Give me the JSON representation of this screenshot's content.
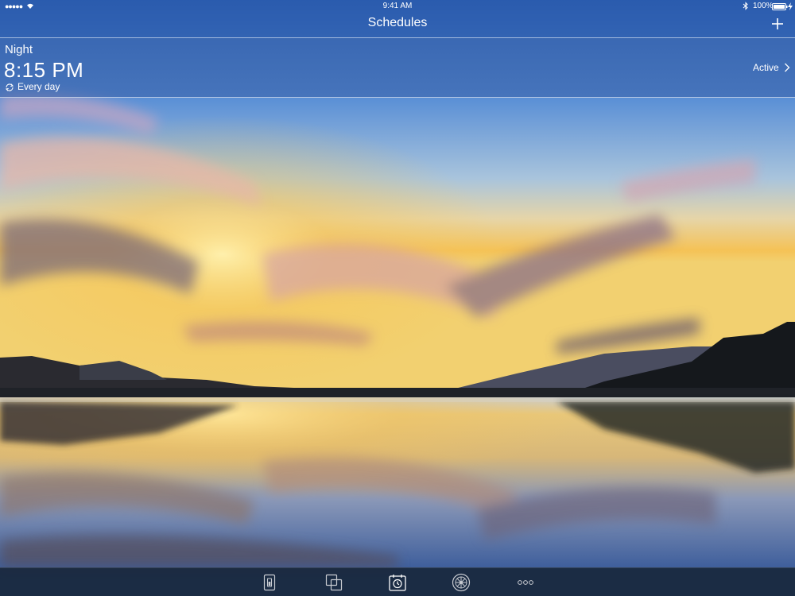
{
  "status_bar": {
    "signal": "●●●●●",
    "time": "9:41 AM",
    "battery_percent": "100%"
  },
  "nav": {
    "title": "Schedules",
    "add_icon": "plus-icon"
  },
  "schedule": {
    "name": "Night",
    "time": "8:15 PM",
    "repeat": "Every day",
    "status": "Active"
  },
  "tabs": [
    {
      "icon": "device-icon"
    },
    {
      "icon": "scenes-icon"
    },
    {
      "icon": "schedules-icon",
      "selected": true
    },
    {
      "icon": "automation-icon"
    },
    {
      "icon": "more-icon"
    }
  ],
  "colors": {
    "nav_bg": "#2855a5",
    "tab_bar_bg": "#19263a",
    "text": "#ffffff"
  }
}
